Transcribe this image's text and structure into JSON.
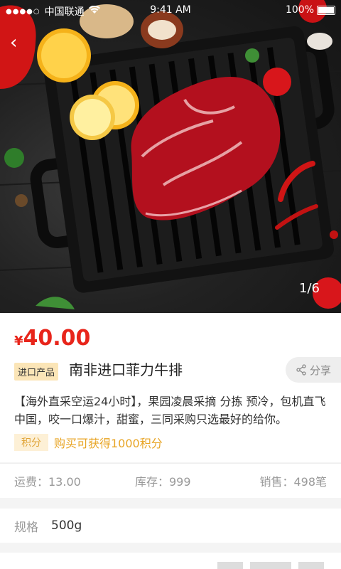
{
  "status_bar": {
    "carrier": "中国联通",
    "time": "9:41 AM",
    "battery": "100%"
  },
  "gallery": {
    "page_indicator": "1/6"
  },
  "product": {
    "currency": "¥",
    "price": "40.00",
    "tag": "进口产品",
    "title": "南非进口菲力牛排",
    "share_label": "分享",
    "description": "【海外直采空运24小时】，果园凌晨采摘 分拣 预冷，包机直飞中国，咬一口爆汁，甜蜜，三同采购只选最好的给你。",
    "points_label": "积分",
    "points_text": "购买可获得1000积分"
  },
  "stats": {
    "shipping": "运费：13.00",
    "stock": "库存：999",
    "sales": "销售：498笔"
  },
  "spec": {
    "label": "规格",
    "value": "500g"
  },
  "colors": {
    "price_red": "#e8251b",
    "tag_bg": "#fbe5b7",
    "points_orange": "#e8a526"
  }
}
